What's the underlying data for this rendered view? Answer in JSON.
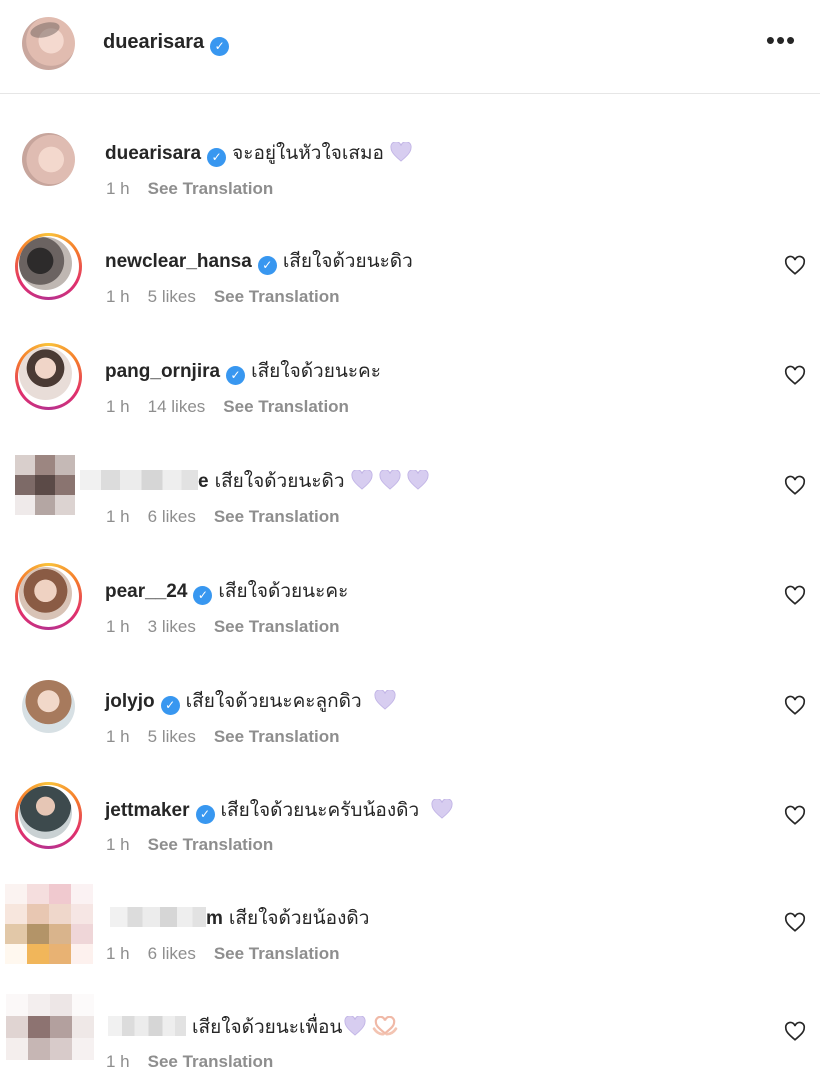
{
  "post_header": {
    "username": "duearisara",
    "verified": true,
    "more_label": "•••"
  },
  "colors": {
    "verified_badge": "#3897f0",
    "meta_text": "#8e8e8e",
    "emoji_heart": "#c9b8ec"
  },
  "comments": [
    {
      "username": "duearisara",
      "verified": true,
      "text": "จะอยู่ในหัวใจเสมอ",
      "emoji": "light-purple-heart",
      "time": "1 h",
      "likes": "",
      "translate": "See Translation",
      "has_like": false
    },
    {
      "username": "newclear_hansa",
      "verified": true,
      "text": "เสียใจด้วยนะดิว",
      "emoji": "",
      "time": "1 h",
      "likes": "5 likes",
      "translate": "See Translation",
      "has_like": true
    },
    {
      "username": "pang_ornjira",
      "verified": true,
      "text": "เสียใจด้วยนะคะ",
      "emoji": "",
      "time": "1 h",
      "likes": "14 likes",
      "translate": "See Translation",
      "has_like": true
    },
    {
      "username": "e",
      "verified": false,
      "text": "เสียใจด้วยนะดิว",
      "emoji": "light-purple-heart x3",
      "time": "1 h",
      "likes": "6 likes",
      "translate": "See Translation",
      "has_like": true
    },
    {
      "username": "pear__24",
      "verified": true,
      "text": "เสียใจด้วยนะคะ",
      "emoji": "",
      "time": "1 h",
      "likes": "3 likes",
      "translate": "See Translation",
      "has_like": true
    },
    {
      "username": "jolyjo",
      "verified": true,
      "text": "เสียใจด้วยนะคะลูกดิว",
      "emoji": "light-purple-heart",
      "time": "1 h",
      "likes": "5 likes",
      "translate": "See Translation",
      "has_like": true
    },
    {
      "username": "jettmaker",
      "verified": true,
      "text": "เสียใจด้วยนะครับน้องดิว",
      "emoji": "light-purple-heart",
      "time": "1 h",
      "likes": "",
      "translate": "See Translation",
      "has_like": true
    },
    {
      "username": "m",
      "verified": false,
      "text": "เสียใจด้วยน้องดิว",
      "emoji": "",
      "time": "1 h",
      "likes": "6 likes",
      "translate": "See Translation",
      "has_like": true
    },
    {
      "username": "",
      "verified": false,
      "text": "เสียใจด้วยนะเพื่อน",
      "emoji": "light-purple-heart, heart-hands",
      "time": "1 h",
      "likes": "",
      "translate": "See Translation",
      "has_like": true
    }
  ]
}
